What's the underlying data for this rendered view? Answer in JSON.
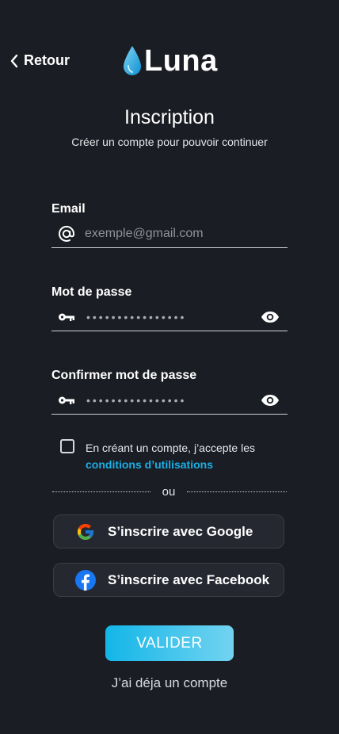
{
  "nav": {
    "back_label": "Retour"
  },
  "brand": {
    "name": "Luna"
  },
  "header": {
    "title": "Inscription",
    "subtitle": "Créer un compte pour pouvoir continuer"
  },
  "form": {
    "email": {
      "label": "Email",
      "placeholder": "exemple@gmail.com",
      "icon": "at-icon"
    },
    "password": {
      "label": "Mot de passe",
      "masked_value": "••••••••••••••••",
      "icon": "key-icon",
      "toggle_icon": "eye-icon"
    },
    "confirm_password": {
      "label": "Confirmer mot de passe",
      "masked_value": "••••••••••••••••",
      "icon": "key-icon",
      "toggle_icon": "eye-icon"
    },
    "terms": {
      "checked": false,
      "text": "En créant un compte, j’accepte les",
      "link": "conditions d’utilisations"
    }
  },
  "separator": {
    "label": "ou"
  },
  "social": {
    "google_label": "S’inscrire avec Google",
    "facebook_label": "S’inscrire avec Facebook"
  },
  "actions": {
    "submit_label": "VALIDER",
    "login_link": "J’ai déja un compte"
  },
  "colors": {
    "background": "#1b1d24",
    "accent": "#12b6e8",
    "link": "#1ab0e6",
    "button_bg": "#252831"
  }
}
